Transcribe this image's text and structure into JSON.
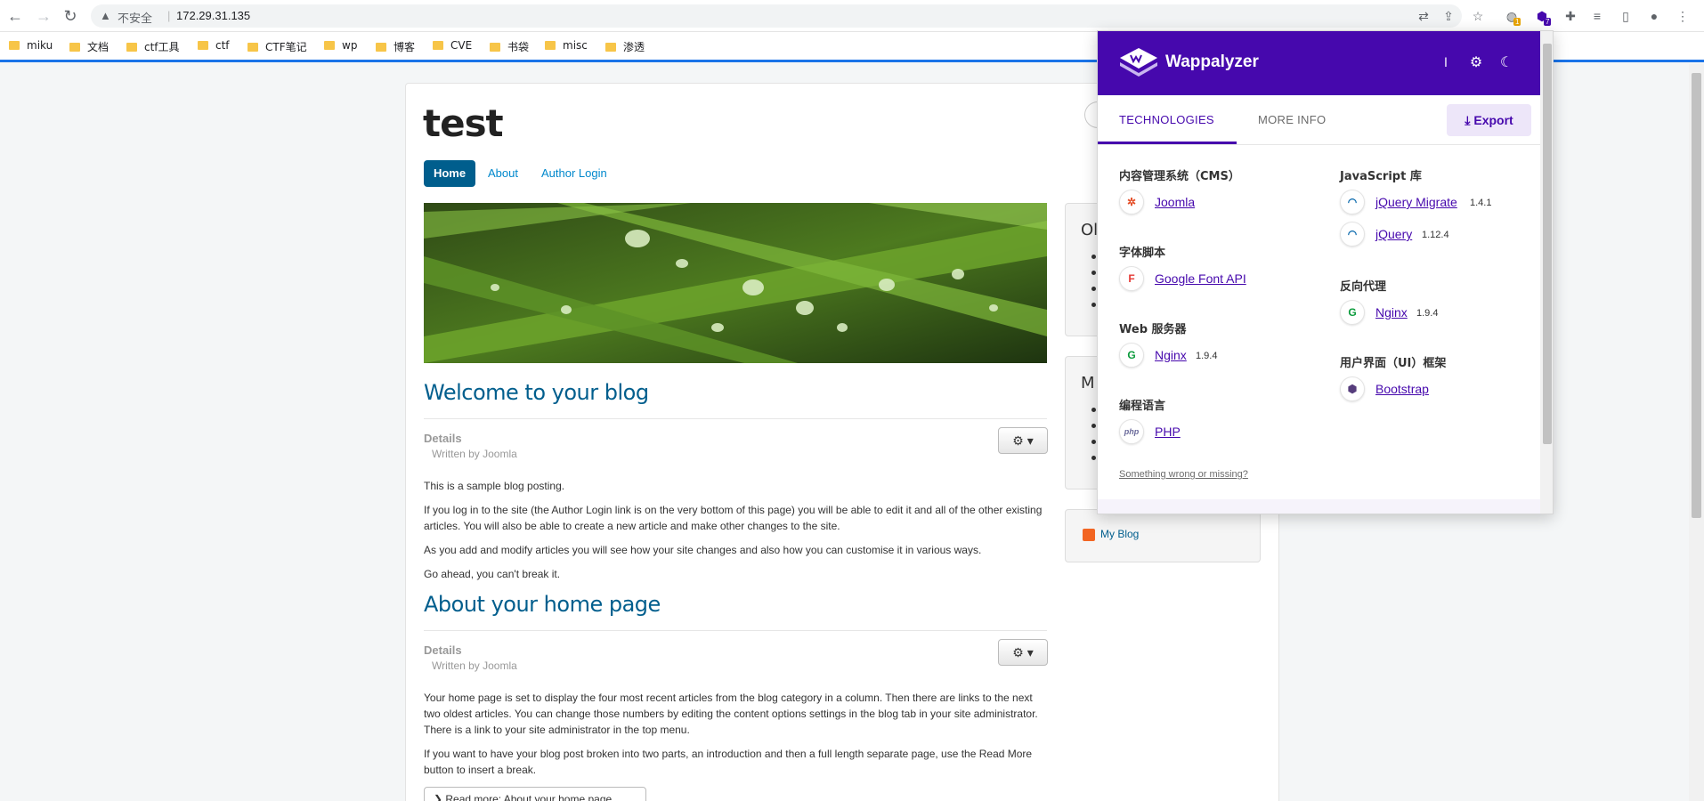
{
  "browser": {
    "url_warning": "不安全",
    "url": "172.29.31.135",
    "bookmarks": [
      "miku",
      "文档",
      "ctf工具",
      "ctf",
      "CTF笔记",
      "wp",
      "博客",
      "CVE",
      "书袋",
      "misc",
      "渗透"
    ],
    "ext_badge_1": "1",
    "ext_badge_2": "7"
  },
  "site": {
    "title": "test",
    "nav": [
      "Home",
      "About",
      "Author Login"
    ]
  },
  "articles": [
    {
      "title": "Welcome to your blog",
      "details_label": "Details",
      "written_by": "Written by Joomla",
      "paragraphs": [
        "This is a sample blog posting.",
        "If you log in to the site (the Author Login link is on the very bottom of this page) you will be able to edit it and all of the other existing articles. You will also be able to create a new article and make other changes to the site.",
        "As you add and modify articles you will see how your site changes and also how you can customise it in various ways.",
        "Go ahead, you can't break it."
      ]
    },
    {
      "title": "About your home page",
      "details_label": "Details",
      "written_by": "Written by Joomla",
      "paragraphs": [
        "Your home page is set to display the four most recent articles from the blog category in a column. Then there are links to the next two oldest articles. You can change those numbers by editing the content options settings in the blog tab in your site administrator. There is a link to your site administrator in the top menu.",
        "If you want to have your blog post broken into two parts, an introduction and then a full length separate page, use the Read More button to insert a break."
      ],
      "read_more": "Read more: About your home page"
    }
  ],
  "sidebar": {
    "box1_heading_partial": "Ol",
    "box2_heading_partial": "M",
    "feed_link": "My Blog"
  },
  "wappalyzer": {
    "name": "Wappalyzer",
    "tabs": [
      "TECHNOLOGIES",
      "MORE INFO"
    ],
    "export_label": "Export",
    "footer_link": "Something wrong or missing?",
    "left_column": [
      {
        "category": "内容管理系统（CMS）",
        "items": [
          {
            "name": "Joomla",
            "version": "",
            "icon": "joomla-icon"
          }
        ]
      },
      {
        "category": "字体脚本",
        "items": [
          {
            "name": "Google Font API",
            "version": "",
            "icon": "google-font-icon"
          }
        ]
      },
      {
        "category": "Web 服务器",
        "items": [
          {
            "name": "Nginx",
            "version": "1.9.4",
            "icon": "nginx-icon"
          }
        ]
      },
      {
        "category": "编程语言",
        "items": [
          {
            "name": "PHP",
            "version": "",
            "icon": "php-icon"
          }
        ]
      }
    ],
    "right_column": [
      {
        "category": "JavaScript 库",
        "items": [
          {
            "name": "jQuery Migrate",
            "version": "1.4.1",
            "icon": "jquery-icon"
          },
          {
            "name": "jQuery",
            "version": "1.12.4",
            "icon": "jquery-icon"
          }
        ]
      },
      {
        "category": "反向代理",
        "items": [
          {
            "name": "Nginx",
            "version": "1.9.4",
            "icon": "nginx-icon"
          }
        ]
      },
      {
        "category": "用户界面（UI）框架",
        "items": [
          {
            "name": "Bootstrap",
            "version": "",
            "icon": "bootstrap-icon"
          }
        ]
      }
    ],
    "colors": {
      "brand": "#4608ad",
      "export_bg": "#ede6f9"
    }
  }
}
